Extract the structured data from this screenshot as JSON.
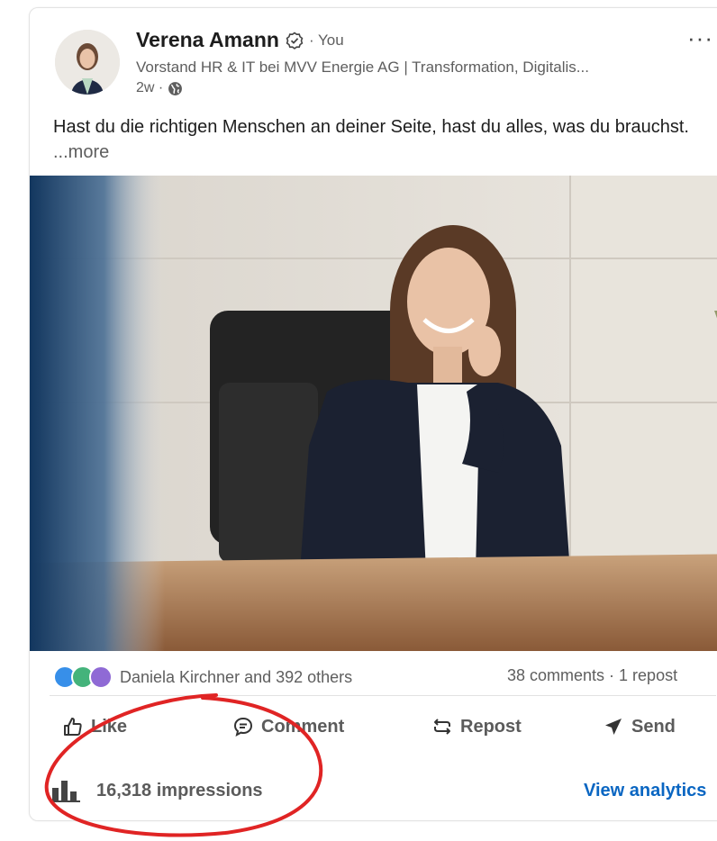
{
  "post": {
    "author": "Verena Amann",
    "relation": "· You",
    "headline": "Vorstand HR & IT bei MVV Energie AG | Transformation, Digitalis...",
    "age": "2w ·",
    "text": "Hast du die richtigen Menschen an deiner Seite, hast du alles, was du brauchst.",
    "see_more": "...more"
  },
  "social": {
    "reactors": "Daniela Kirchner and 392 others",
    "counts": "38 comments · 1 repost"
  },
  "actions": {
    "like": "Like",
    "comment": "Comment",
    "repost": "Repost",
    "send": "Send"
  },
  "analytics": {
    "impressions": "16,318 impressions",
    "view_label": "View analytics"
  },
  "colors": {
    "link_blue": "#0a66c2",
    "annotation_red": "#e02424"
  },
  "icons": [
    "verified-icon",
    "globe-icon",
    "more-icon",
    "like-icon",
    "comment-icon",
    "repost-icon",
    "send-icon",
    "analytics-chart-icon"
  ]
}
